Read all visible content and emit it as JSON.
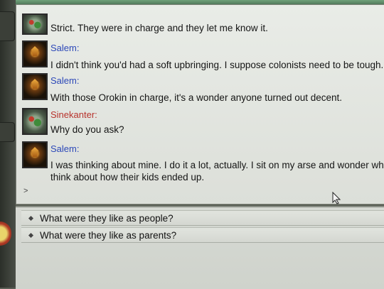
{
  "chat": {
    "messages": [
      {
        "speaker": "",
        "side": "sine",
        "text": [
          "Strict. They were in charge and they let me know it."
        ]
      },
      {
        "speaker": "Salem:",
        "side": "salem",
        "text": [
          "I didn't think you'd had a soft upbringing. I suppose colonists need to be tough."
        ]
      },
      {
        "speaker": "Salem:",
        "side": "salem",
        "text": [
          "With those Orokin in charge, it's a wonder anyone turned out decent."
        ]
      },
      {
        "speaker": "Sinekanter:",
        "side": "sine",
        "text": [
          "Why do you ask?"
        ]
      },
      {
        "speaker": "Salem:",
        "side": "salem",
        "text": [
          "I was thinking about mine. I do it a lot, actually. I sit on my arse and wonder what",
          "think about how their kids ended up."
        ]
      }
    ],
    "input_prompt": ">"
  },
  "options": [
    {
      "label": "What were they like as people?"
    },
    {
      "label": "What were they like as parents?"
    }
  ],
  "colors": {
    "salem": "#2c48b8",
    "sinekanter": "#b8322c"
  }
}
